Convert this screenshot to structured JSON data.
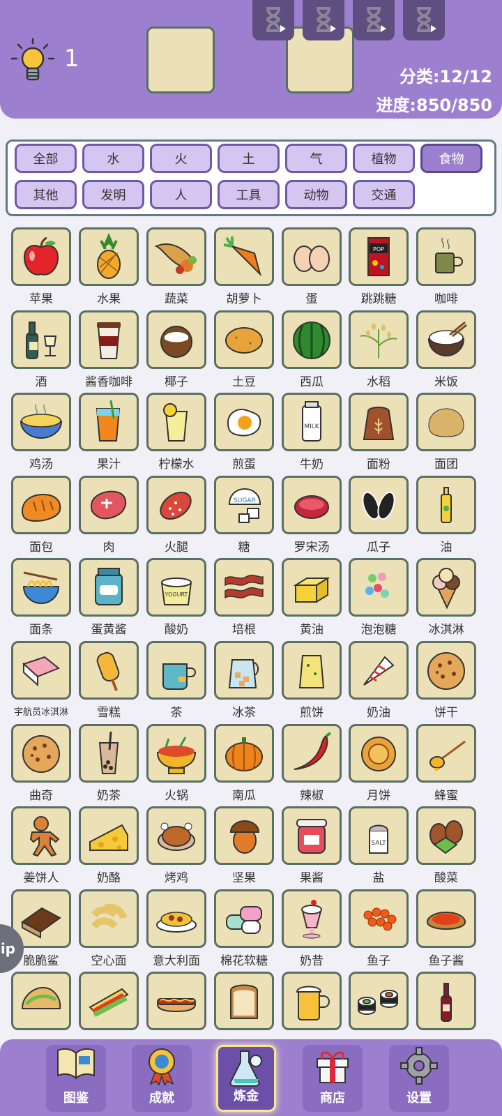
{
  "header": {
    "hint_count": "1",
    "category_progress": "分类:12/12",
    "overall_progress": "进度:850/850",
    "timers": [
      "hourglass-icon",
      "hourglass-icon",
      "hourglass-icon",
      "hourglass-icon"
    ]
  },
  "filters": [
    {
      "label": "全部",
      "active": false
    },
    {
      "label": "水",
      "active": false
    },
    {
      "label": "火",
      "active": false
    },
    {
      "label": "土",
      "active": false
    },
    {
      "label": "气",
      "active": false
    },
    {
      "label": "植物",
      "active": false
    },
    {
      "label": "食物",
      "active": true
    },
    {
      "label": "其他",
      "active": false
    },
    {
      "label": "发明",
      "active": false
    },
    {
      "label": "人",
      "active": false
    },
    {
      "label": "工具",
      "active": false
    },
    {
      "label": "动物",
      "active": false
    },
    {
      "label": "交通",
      "active": false
    }
  ],
  "items": [
    {
      "label": "苹果",
      "icon": "apple-icon"
    },
    {
      "label": "水果",
      "icon": "pineapple-icon"
    },
    {
      "label": "蔬菜",
      "icon": "cornucopia-icon"
    },
    {
      "label": "胡萝卜",
      "icon": "carrot-icon"
    },
    {
      "label": "蛋",
      "icon": "egg-icon"
    },
    {
      "label": "跳跳糖",
      "icon": "pop-rocks-icon"
    },
    {
      "label": "咖啡",
      "icon": "coffee-mug-icon"
    },
    {
      "label": "酒",
      "icon": "wine-bottle-icon"
    },
    {
      "label": "酱香咖啡",
      "icon": "coffee-cup-icon"
    },
    {
      "label": "椰子",
      "icon": "coconut-icon"
    },
    {
      "label": "土豆",
      "icon": "potato-icon"
    },
    {
      "label": "西瓜",
      "icon": "watermelon-icon"
    },
    {
      "label": "水稻",
      "icon": "rice-plant-icon"
    },
    {
      "label": "米饭",
      "icon": "rice-bowl-icon"
    },
    {
      "label": "鸡汤",
      "icon": "soup-bowl-icon"
    },
    {
      "label": "果汁",
      "icon": "juice-icon"
    },
    {
      "label": "柠檬水",
      "icon": "lemonade-icon"
    },
    {
      "label": "煎蛋",
      "icon": "fried-egg-icon"
    },
    {
      "label": "牛奶",
      "icon": "milk-icon"
    },
    {
      "label": "面粉",
      "icon": "flour-sack-icon"
    },
    {
      "label": "面团",
      "icon": "dough-icon"
    },
    {
      "label": "面包",
      "icon": "bread-icon"
    },
    {
      "label": "肉",
      "icon": "meat-icon"
    },
    {
      "label": "火腿",
      "icon": "ham-icon"
    },
    {
      "label": "糖",
      "icon": "sugar-icon"
    },
    {
      "label": "罗宋汤",
      "icon": "borscht-icon"
    },
    {
      "label": "瓜子",
      "icon": "sunflower-seeds-icon"
    },
    {
      "label": "油",
      "icon": "oil-bottle-icon"
    },
    {
      "label": "面条",
      "icon": "noodles-icon"
    },
    {
      "label": "蛋黄酱",
      "icon": "mayonnaise-icon"
    },
    {
      "label": "酸奶",
      "icon": "yogurt-icon"
    },
    {
      "label": "培根",
      "icon": "bacon-icon"
    },
    {
      "label": "黄油",
      "icon": "butter-icon"
    },
    {
      "label": "泡泡糖",
      "icon": "gumballs-icon"
    },
    {
      "label": "冰淇淋",
      "icon": "ice-cream-icon"
    },
    {
      "label": "宇航员冰淇淋",
      "icon": "astronaut-ice-cream-icon"
    },
    {
      "label": "雪糕",
      "icon": "popsicle-icon"
    },
    {
      "label": "茶",
      "icon": "tea-icon"
    },
    {
      "label": "冰茶",
      "icon": "iced-tea-icon"
    },
    {
      "label": "煎饼",
      "icon": "pancake-icon"
    },
    {
      "label": "奶油",
      "icon": "cream-icon"
    },
    {
      "label": "饼干",
      "icon": "cookie-icon"
    },
    {
      "label": "曲奇",
      "icon": "cookie-icon"
    },
    {
      "label": "奶茶",
      "icon": "bubble-tea-icon"
    },
    {
      "label": "火锅",
      "icon": "hotpot-icon"
    },
    {
      "label": "南瓜",
      "icon": "pumpkin-icon"
    },
    {
      "label": "辣椒",
      "icon": "chili-icon"
    },
    {
      "label": "月饼",
      "icon": "mooncake-icon"
    },
    {
      "label": "蜂蜜",
      "icon": "honey-icon"
    },
    {
      "label": "姜饼人",
      "icon": "gingerbread-icon"
    },
    {
      "label": "奶酪",
      "icon": "cheese-icon"
    },
    {
      "label": "烤鸡",
      "icon": "roast-chicken-icon"
    },
    {
      "label": "坚果",
      "icon": "acorn-icon"
    },
    {
      "label": "果酱",
      "icon": "jam-icon"
    },
    {
      "label": "盐",
      "icon": "salt-icon"
    },
    {
      "label": "酸菜",
      "icon": "pickles-icon"
    },
    {
      "label": "脆脆鲨",
      "icon": "wafer-icon"
    },
    {
      "label": "空心面",
      "icon": "macaroni-icon"
    },
    {
      "label": "意大利面",
      "icon": "spaghetti-icon"
    },
    {
      "label": "棉花软糖",
      "icon": "marshmallow-icon"
    },
    {
      "label": "奶昔",
      "icon": "milkshake-icon"
    },
    {
      "label": "鱼子",
      "icon": "roe-icon"
    },
    {
      "label": "鱼子酱",
      "icon": "caviar-icon"
    },
    {
      "label": "",
      "icon": "taco-icon"
    },
    {
      "label": "",
      "icon": "sandwich-icon"
    },
    {
      "label": "",
      "icon": "hotdog-icon"
    },
    {
      "label": "",
      "icon": "toast-icon"
    },
    {
      "label": "",
      "icon": "beer-icon"
    },
    {
      "label": "",
      "icon": "sushi-icon"
    },
    {
      "label": "",
      "icon": "wine-icon"
    }
  ],
  "side_tab": "ip",
  "nav": [
    {
      "label": "图鉴",
      "icon": "book-icon",
      "active": false
    },
    {
      "label": "成就",
      "icon": "medal-icon",
      "active": false
    },
    {
      "label": "炼金",
      "icon": "flask-icon",
      "active": true
    },
    {
      "label": "商店",
      "icon": "gift-icon",
      "active": false
    },
    {
      "label": "设置",
      "icon": "gear-icon",
      "active": false
    }
  ]
}
